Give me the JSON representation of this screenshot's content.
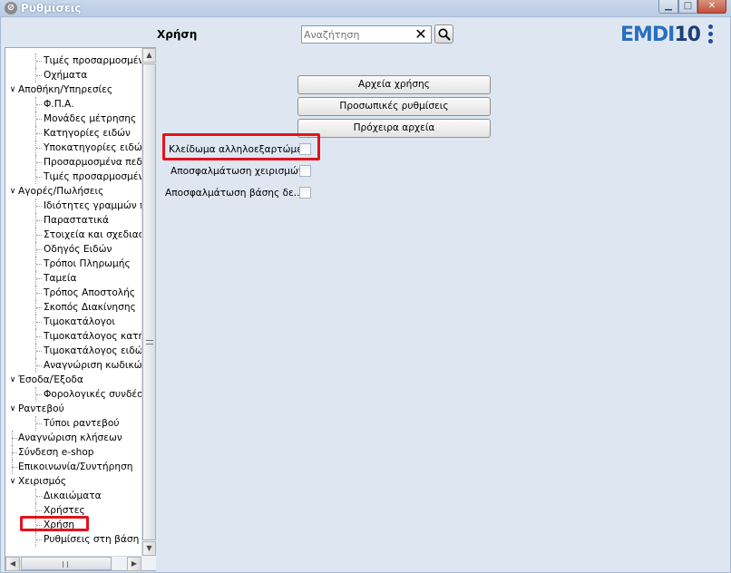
{
  "window": {
    "title": "Ρυθμίσεις",
    "min_glyph": "▁",
    "max_glyph": "□",
    "close_glyph": "✕"
  },
  "header": {
    "section_title": "Χρήση",
    "search_placeholder": "Αναζήτηση",
    "clear_glyph": "✕",
    "logo_a": "EMDI",
    "logo_b": "10"
  },
  "tree": [
    {
      "label": "Τιμές προσαρμοσμένω",
      "level": 1
    },
    {
      "label": "Οχήματα",
      "level": 1
    },
    {
      "label": "Αποθήκη/Υπηρεσίες",
      "level": 0,
      "expanded": true
    },
    {
      "label": "Φ.Π.Α.",
      "level": 1
    },
    {
      "label": "Μονάδες μέτρησης",
      "level": 1
    },
    {
      "label": "Κατηγορίες ειδών",
      "level": 1
    },
    {
      "label": "Υποκατηγορίες ειδών",
      "level": 1
    },
    {
      "label": "Προσαρμοσμένα πεδί",
      "level": 1
    },
    {
      "label": "Τιμές προσαρμοσμένω",
      "level": 1
    },
    {
      "label": "Αγορές/Πωλήσεις",
      "level": 0,
      "expanded": true
    },
    {
      "label": "Ιδιότητες γραμμών πα",
      "level": 1
    },
    {
      "label": "Παραστατικά",
      "level": 1
    },
    {
      "label": "Στοιχεία και σχεδιασμό",
      "level": 1
    },
    {
      "label": "Οδηγός Ειδών",
      "level": 1
    },
    {
      "label": "Τρόποι Πληρωμής",
      "level": 1
    },
    {
      "label": "Ταμεία",
      "level": 1
    },
    {
      "label": "Τρόπος Αποστολής",
      "level": 1
    },
    {
      "label": "Σκοπός Διακίνησης",
      "level": 1
    },
    {
      "label": "Τιμοκατάλογοι",
      "level": 1
    },
    {
      "label": "Τιμοκατάλογος κατηγο",
      "level": 1
    },
    {
      "label": "Τιμοκατάλογος ειδών",
      "level": 1
    },
    {
      "label": "Αναγνώριση κωδικών",
      "level": 1
    },
    {
      "label": "Έσοδα/Έξοδα",
      "level": 0,
      "expanded": true
    },
    {
      "label": "Φορολογικές συνδέσει",
      "level": 1
    },
    {
      "label": "Ραντεβού",
      "level": 0,
      "expanded": true
    },
    {
      "label": "Τύποι ραντεβού",
      "level": 1
    },
    {
      "label": "Αναγνώριση κλήσεων",
      "level": 0
    },
    {
      "label": "Σύνδεση e-shop",
      "level": 0
    },
    {
      "label": "Επικοινωνία/Συντήρηση",
      "level": 0
    },
    {
      "label": "Χειρισμός",
      "level": 0,
      "expanded": true
    },
    {
      "label": "Δικαιώματα",
      "level": 1
    },
    {
      "label": "Χρήστες",
      "level": 1
    },
    {
      "label": "Χρήση",
      "level": 1,
      "selected": true
    },
    {
      "label": "Ρυθμίσεις στη βάση",
      "level": 1
    }
  ],
  "scroll": {
    "up": "▲",
    "down": "▼",
    "left": "◀",
    "right": "▶"
  },
  "buttons": [
    {
      "label": "Αρχεία χρήσης"
    },
    {
      "label": "Προσωπικές ρυθμίσεις"
    },
    {
      "label": "Πρόχειρα αρχεία"
    }
  ],
  "options": [
    {
      "label": "Κλείδωμα αλληλοεξαρτώμε...",
      "checked": false,
      "highlighted": true
    },
    {
      "label": "Αποσφαλμάτωση χειρισμών",
      "checked": false
    },
    {
      "label": "Αποσφαλμάτωση βάσης δε...",
      "checked": false
    }
  ],
  "colors": {
    "highlight": "#e0141c",
    "logo_light": "#2a6fbf",
    "logo_dark": "#1c3f77"
  }
}
